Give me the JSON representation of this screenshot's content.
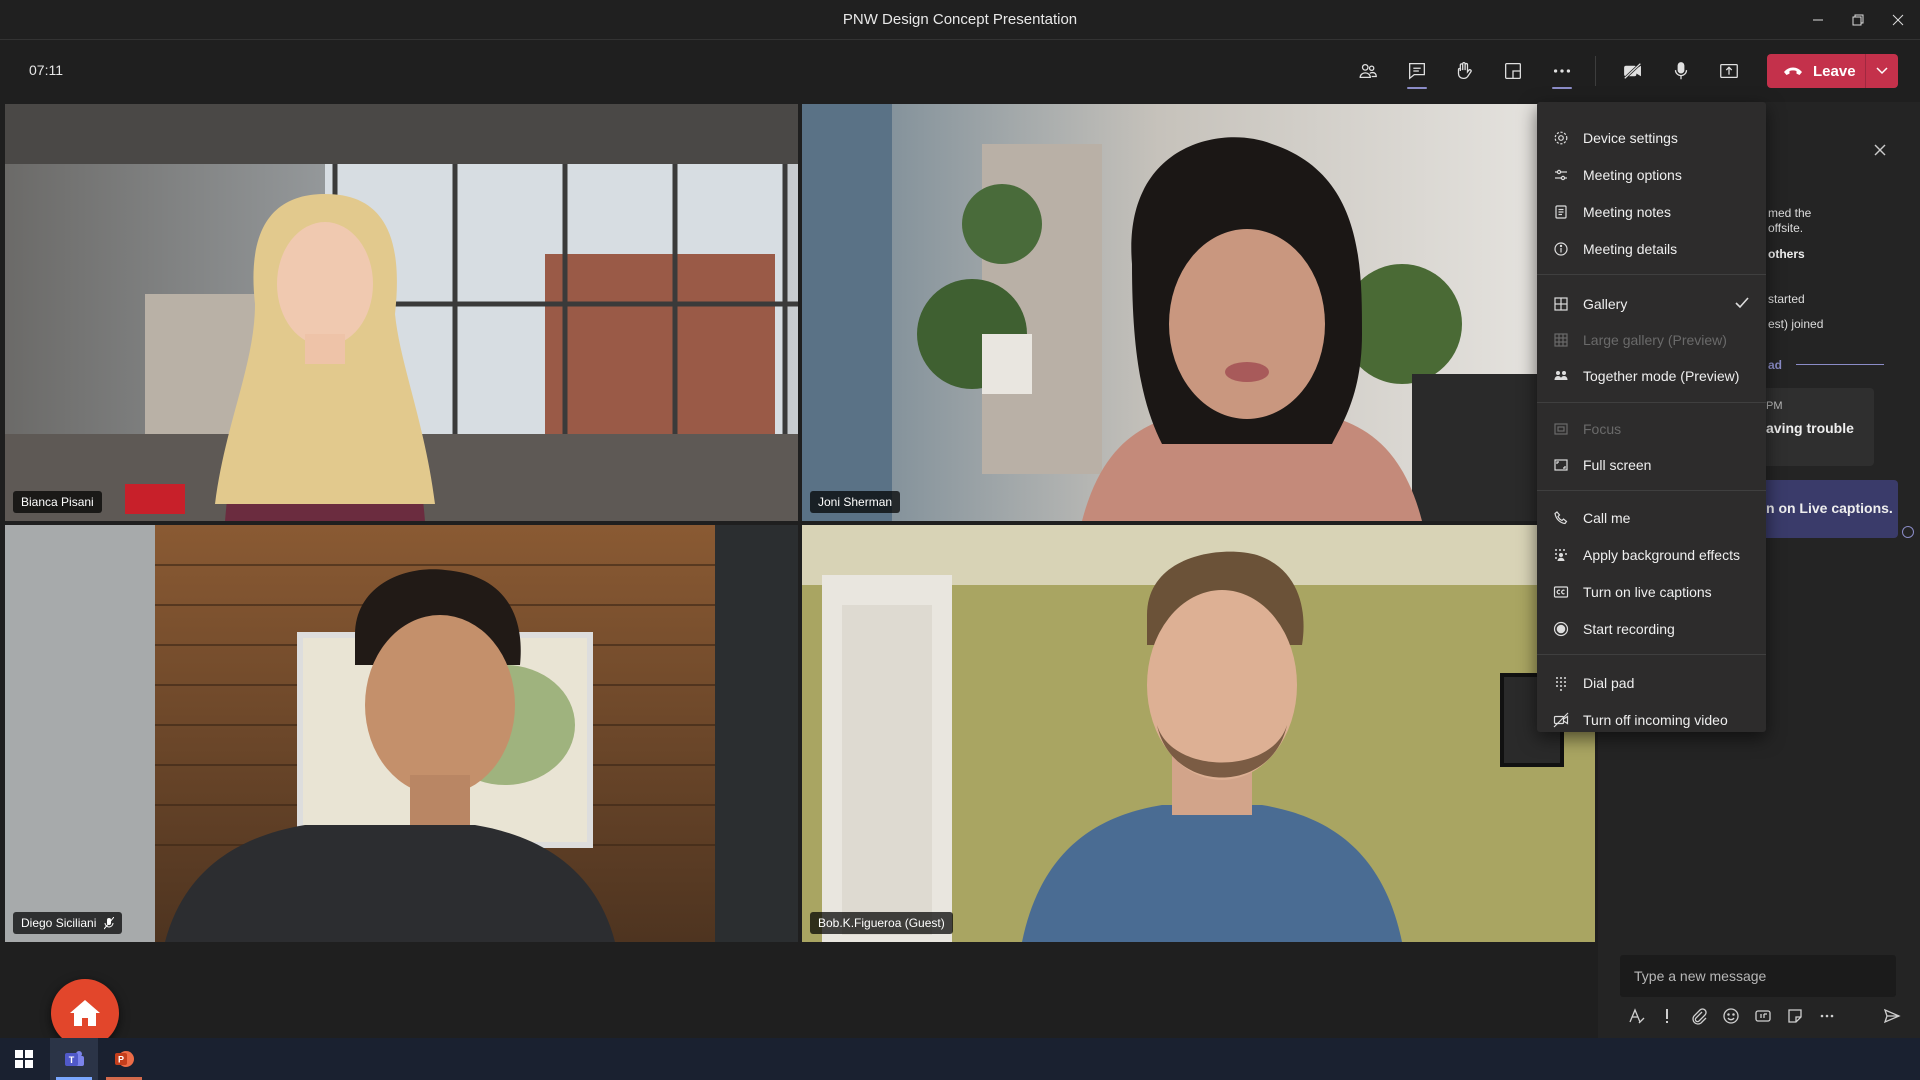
{
  "window": {
    "title": "PNW Design Concept Presentation"
  },
  "toolbar": {
    "timer": "07:11",
    "leave_label": "Leave"
  },
  "participants": [
    {
      "name": "Bianca Pisani"
    },
    {
      "name": "Joni Sherman"
    },
    {
      "name": "Diego Siciliani"
    },
    {
      "name": "Bob.K.Figueroa (Guest)"
    }
  ],
  "menu": {
    "items": [
      {
        "label": "Device settings"
      },
      {
        "label": "Meeting options"
      },
      {
        "label": "Meeting notes"
      },
      {
        "label": "Meeting details"
      },
      {
        "label": "Gallery"
      },
      {
        "label": "Large gallery (Preview)"
      },
      {
        "label": "Together mode (Preview)"
      },
      {
        "label": "Focus"
      },
      {
        "label": "Full screen"
      },
      {
        "label": "Call me"
      },
      {
        "label": "Apply background effects"
      },
      {
        "label": "Turn on live captions"
      },
      {
        "label": "Start recording"
      },
      {
        "label": "Dial pad"
      },
      {
        "label": "Turn off incoming video"
      }
    ]
  },
  "chat": {
    "snippets": [
      "med the",
      "offsite.",
      "others",
      "started",
      "est) joined",
      "ad",
      "PM",
      "aving trouble",
      "n on Live captions."
    ],
    "compose_placeholder": "Type a new message"
  },
  "colors": {
    "leave": "#c4314b",
    "accent": "#8b8cc7",
    "fab": "#e2462b"
  }
}
